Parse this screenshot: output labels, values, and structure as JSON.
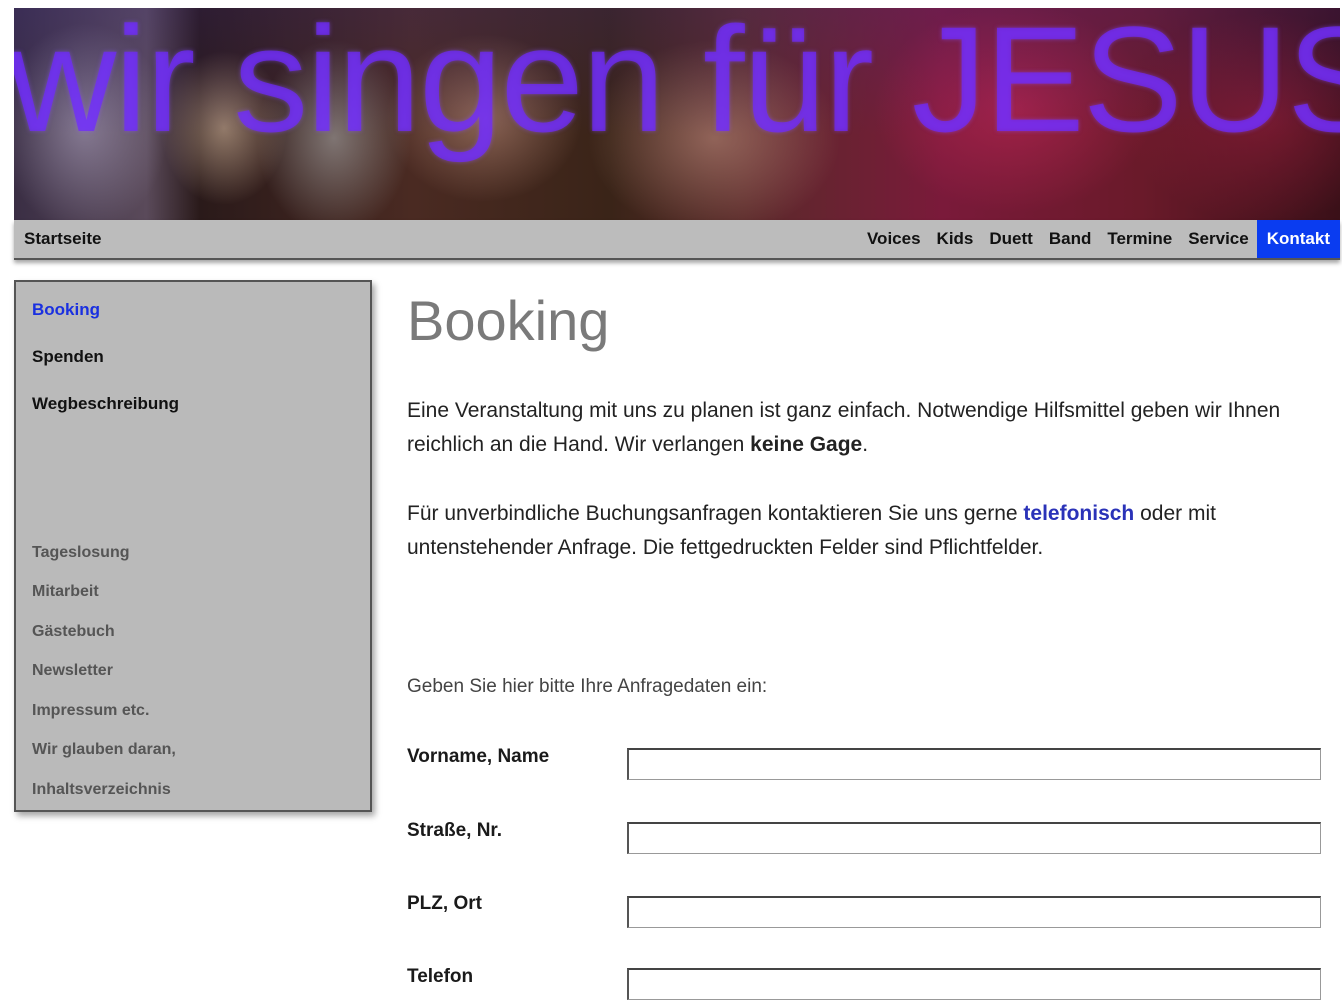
{
  "header": {
    "banner_text": "wir singen für JESUS"
  },
  "nav": {
    "home": "Startseite",
    "items": [
      {
        "label": "Voices",
        "active": false
      },
      {
        "label": "Kids",
        "active": false
      },
      {
        "label": "Duett",
        "active": false
      },
      {
        "label": "Band",
        "active": false
      },
      {
        "label": "Termine",
        "active": false
      },
      {
        "label": "Service",
        "active": false
      },
      {
        "label": "Kontakt",
        "active": true
      }
    ]
  },
  "sidebar": {
    "primary": [
      "Booking",
      "Spenden",
      "Wegbeschreibung"
    ],
    "secondary": [
      "Tageslosung",
      "Mitarbeit",
      "Gästebuch",
      "Newsletter",
      "Impressum etc.",
      "Wir glauben daran,",
      "Inhaltsverzeichnis"
    ]
  },
  "main": {
    "title": "Booking",
    "para1_a": "Eine Veranstaltung mit uns zu planen ist ganz einfach. Notwendige Hilfsmittel geben wir Ihnen reichlich an die Hand. Wir verlangen ",
    "para1_bold": "keine Gage",
    "para1_b": ".",
    "para2_a": "Für unverbindliche Buchungsanfragen kontaktieren Sie uns gerne ",
    "para2_link": "telefonisch",
    "para2_b": " oder mit untenstehender Anfrage. Die fettgedruckten Felder sind Pflichtfelder.",
    "form_intro": "Geben Sie hier bitte Ihre Anfragedaten ein:"
  },
  "form": {
    "fields": [
      {
        "label": "Vorname, Name",
        "value": ""
      },
      {
        "label": "Straße, Nr.",
        "value": ""
      },
      {
        "label": "PLZ, Ort",
        "value": ""
      },
      {
        "label": "Telefon",
        "value": ""
      }
    ]
  },
  "colors": {
    "nav_active": "#0a3cf0",
    "sidebar_bg": "#bababa",
    "link": "#2a32b8"
  }
}
